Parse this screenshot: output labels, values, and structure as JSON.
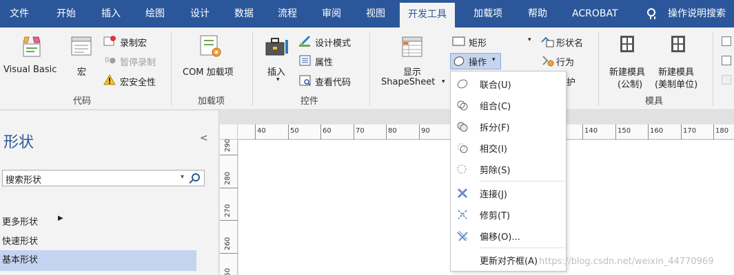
{
  "tabs": [
    "文件",
    "开始",
    "插入",
    "绘图",
    "设计",
    "数据",
    "流程",
    "审阅",
    "视图",
    "开发工具",
    "加载项",
    "帮助",
    "ACROBAT"
  ],
  "active_tab": "开发工具",
  "tell_me": "操作说明搜索",
  "ribbon": {
    "code": {
      "visual_basic": "Visual Basic",
      "macros": "宏",
      "record_macro": "录制宏",
      "pause_recording": "暂停录制",
      "macro_security": "宏安全性",
      "label": "代码"
    },
    "addins": {
      "com_addins": "COM 加载项",
      "label": "加载项"
    },
    "controls": {
      "insert": "插入",
      "design_mode": "设计模式",
      "properties": "属性",
      "view_code": "查看代码",
      "label": "控件"
    },
    "show_shapesheet": {
      "line1": "显示",
      "line2": "ShapeSheet"
    },
    "shape_design": {
      "rectangle": "矩形",
      "operations": "操作",
      "shape_name": "形状名",
      "behavior": "行为",
      "protect_partial": "护"
    },
    "stencil": {
      "new_stencil_metric_line1": "新建模具",
      "new_stencil_metric_line2": "(公制)",
      "new_stencil_us_line1": "新建模具",
      "new_stencil_us_line2": "(美制单位)",
      "label": "模具"
    }
  },
  "shapes_panel": {
    "title": "形状",
    "search_placeholder": "搜索形状",
    "more_shapes": "更多形状",
    "quick_shapes": "快速形状",
    "basic_shapes": "基本形状"
  },
  "ruler_top_labels": [
    "40",
    "50",
    "60",
    "70",
    "80",
    "90",
    "140",
    "150",
    "160",
    "170",
    "180"
  ],
  "ruler_left_labels": [
    "290",
    "280",
    "270",
    "260",
    "250"
  ],
  "operations_menu": {
    "items": [
      {
        "label": "联合(U)",
        "icon": "union-icon"
      },
      {
        "label": "组合(C)",
        "icon": "combine-icon"
      },
      {
        "label": "拆分(F)",
        "icon": "fragment-icon"
      },
      {
        "label": "相交(I)",
        "icon": "intersect-icon"
      },
      {
        "label": "剪除(S)",
        "icon": "subtract-icon"
      },
      {
        "label": "连接(J)",
        "icon": "join-icon"
      },
      {
        "label": "修剪(T)",
        "icon": "trim-icon"
      },
      {
        "label": "偏移(O)...",
        "icon": "offset-icon"
      },
      {
        "label": "更新对齐框(A)",
        "icon": ""
      }
    ]
  },
  "watermark": "https://blog.csdn.net/weixin_44770969",
  "colors": {
    "tabbar": "#2b579a",
    "ribbon_bg": "#f3f3f3",
    "selected_item": "#c4d3ef",
    "menu_button_active": "#c5d5ee"
  }
}
